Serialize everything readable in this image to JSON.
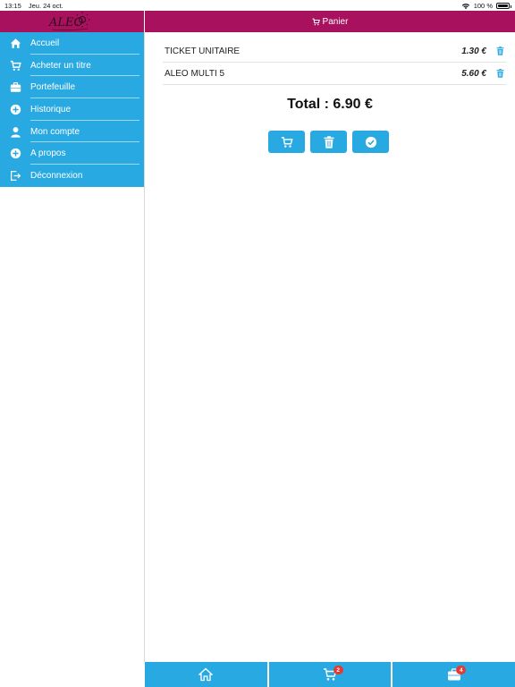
{
  "status_bar": {
    "time": "13:15",
    "date": "Jeu. 24 oct.",
    "battery": "100 %"
  },
  "header": {
    "title": "Panier",
    "logo_text": "ALEO"
  },
  "sidebar": {
    "items": [
      {
        "label": "Accueil",
        "icon": "home-icon"
      },
      {
        "label": "Acheter un titre",
        "icon": "cart-icon"
      },
      {
        "label": "Portefeuille",
        "icon": "wallet-icon"
      },
      {
        "label": "Historique",
        "icon": "plus-circle-icon"
      },
      {
        "label": "Mon compte",
        "icon": "user-icon"
      },
      {
        "label": "A propos",
        "icon": "plus-circle-icon"
      },
      {
        "label": "Déconnexion",
        "icon": "logout-icon"
      }
    ]
  },
  "cart": {
    "items": [
      {
        "name": "TICKET UNITAIRE",
        "price": "1.30 €"
      },
      {
        "name": "ALEO MULTI 5",
        "price": "5.60 €"
      }
    ],
    "total": "Total : 6.90 €"
  },
  "tabbar": {
    "cart_badge": "2",
    "wallet_badge": "4"
  },
  "colors": {
    "header": "#a8115d",
    "accent": "#29a9e1",
    "badge": "#e53935"
  }
}
